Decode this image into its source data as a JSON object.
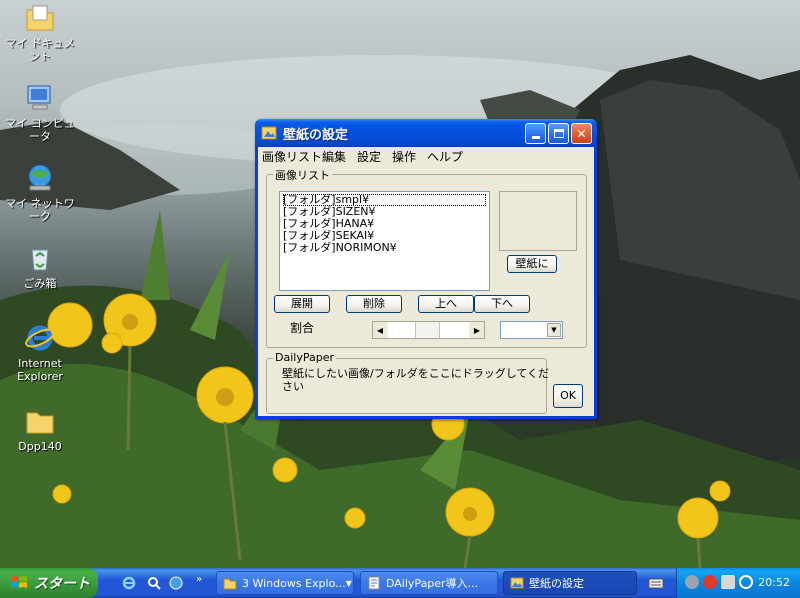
{
  "desktop": {
    "icons": [
      {
        "name": "my-documents",
        "label": "マイ ドキュメント"
      },
      {
        "name": "my-computer",
        "label": "マイ コンピュータ"
      },
      {
        "name": "my-network",
        "label": "マイ ネットワーク"
      },
      {
        "name": "recycle-bin",
        "label": "ごみ箱"
      },
      {
        "name": "internet-explorer",
        "label": "Internet Explorer"
      },
      {
        "name": "dpp140-folder",
        "label": "Dpp140"
      }
    ]
  },
  "window": {
    "title": "壁紙の設定",
    "menu": [
      "画像リスト編集",
      "設定",
      "操作",
      "ヘルプ"
    ],
    "image_list": {
      "legend": "画像リスト",
      "items": [
        "[フォルダ]smpl¥",
        "[フォルダ]SIZEN¥",
        "[フォルダ]HANA¥",
        "[フォルダ]SEKAI¥",
        "[フォルダ]NORIMON¥"
      ],
      "selected_index": 0,
      "set_wallpaper_label": "壁紙に",
      "expand_label": "展開",
      "delete_label": "削除",
      "up_label": "上へ",
      "down_label": "下へ",
      "ratio_label": "割合"
    },
    "dailypaper": {
      "legend": "DailyPaper",
      "instruction": "壁紙にしたい画像/フォルダをここにドラッグしてください",
      "ok_label": "OK"
    }
  },
  "taskbar": {
    "start_label": "スタート",
    "tasks": [
      {
        "label": "3 Windows Explo...",
        "active": false
      },
      {
        "label": "DAilyPaper導入...",
        "active": false
      },
      {
        "label": "壁紙の設定",
        "active": true
      }
    ],
    "clock": "20:52"
  },
  "colors": {
    "title_bar": "#0650dc",
    "client_bg": "#ece9d8",
    "start_green": "#3a963a",
    "taskbar_blue": "#2456d3"
  }
}
